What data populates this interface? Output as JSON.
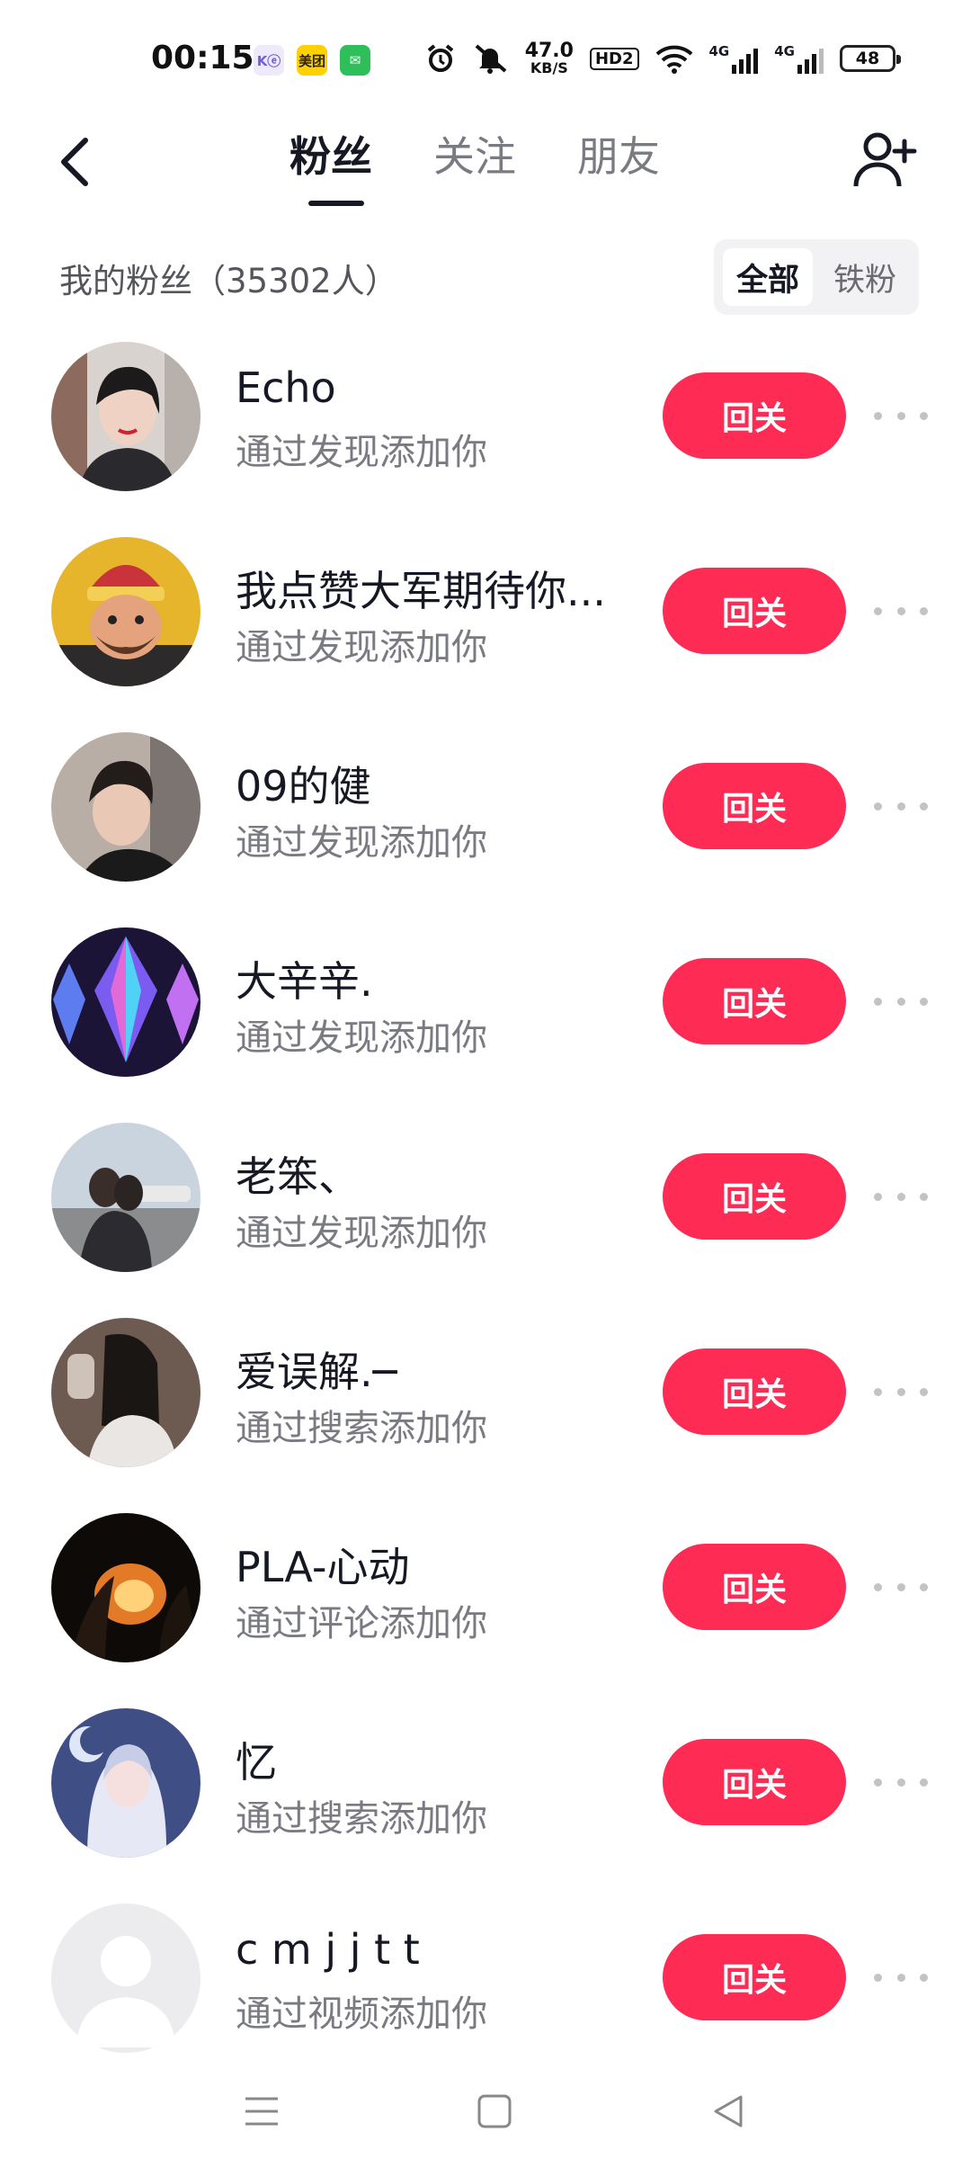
{
  "status_bar": {
    "time": "00:15",
    "app_icons": [
      "Kⓔ",
      "美团",
      "✉"
    ],
    "net_speed_value": "47.0",
    "net_speed_unit": "KB/S",
    "hd_label": "HD2",
    "signal_1_label": "4G",
    "signal_2_label": "4G",
    "battery": "48"
  },
  "header": {
    "tabs": [
      {
        "label": "粉丝",
        "active": true
      },
      {
        "label": "关注",
        "active": false
      },
      {
        "label": "朋友",
        "active": false
      }
    ]
  },
  "section": {
    "title": "我的粉丝（35302人）",
    "filters": [
      {
        "label": "全部",
        "active": true
      },
      {
        "label": "铁粉",
        "active": false
      }
    ]
  },
  "fans": [
    {
      "name": "Echo",
      "source": "通过发现添加你",
      "button": "回关",
      "avatar": "photo-girl"
    },
    {
      "name": "我点赞大军期待你...",
      "source": "通过发现添加你",
      "button": "回关",
      "avatar": "cartoon-warrior"
    },
    {
      "name": "09的健",
      "source": "通过发现添加你",
      "button": "回关",
      "avatar": "photo-boy"
    },
    {
      "name": "大辛辛.",
      "source": "通过发现添加你",
      "button": "回关",
      "avatar": "crystal-gem"
    },
    {
      "name": "老笨、",
      "source": "通过发现添加你",
      "button": "回关",
      "avatar": "photo-couple"
    },
    {
      "name": "爱误解.─",
      "source": "通过搜索添加你",
      "button": "回关",
      "avatar": "photo-dark-girl"
    },
    {
      "name": "PLA-心动",
      "source": "通过评论添加你",
      "button": "回关",
      "avatar": "photo-fire"
    },
    {
      "name": "忆",
      "source": "通过搜索添加你",
      "button": "回关",
      "avatar": "anime-girl"
    },
    {
      "name": "c m j j t t",
      "source": "通过视频添加你",
      "button": "回关",
      "avatar": "default-avatar"
    }
  ],
  "colors": {
    "accent": "#fe2c55",
    "text_primary": "#161823",
    "text_secondary": "#7a7b82"
  }
}
